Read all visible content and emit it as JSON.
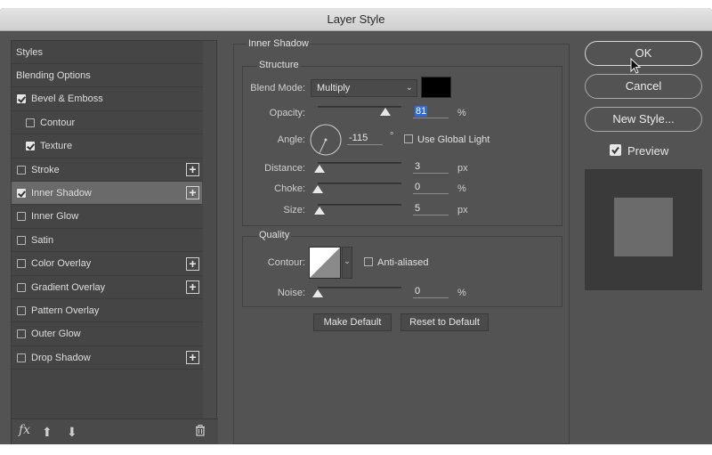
{
  "window": {
    "title": "Layer Style"
  },
  "styles_list": [
    {
      "label": "Styles",
      "checkbox": false,
      "checked": false,
      "indent": false,
      "plus": false,
      "selected": false
    },
    {
      "label": "Blending Options",
      "checkbox": false,
      "checked": false,
      "indent": false,
      "plus": false,
      "selected": false
    },
    {
      "label": "Bevel & Emboss",
      "checkbox": true,
      "checked": true,
      "indent": false,
      "plus": false,
      "selected": false
    },
    {
      "label": "Contour",
      "checkbox": true,
      "checked": false,
      "indent": true,
      "plus": false,
      "selected": false
    },
    {
      "label": "Texture",
      "checkbox": true,
      "checked": true,
      "indent": true,
      "plus": false,
      "selected": false
    },
    {
      "label": "Stroke",
      "checkbox": true,
      "checked": false,
      "indent": false,
      "plus": true,
      "selected": false
    },
    {
      "label": "Inner Shadow",
      "checkbox": true,
      "checked": true,
      "indent": false,
      "plus": true,
      "selected": true
    },
    {
      "label": "Inner Glow",
      "checkbox": true,
      "checked": false,
      "indent": false,
      "plus": false,
      "selected": false
    },
    {
      "label": "Satin",
      "checkbox": true,
      "checked": false,
      "indent": false,
      "plus": false,
      "selected": false
    },
    {
      "label": "Color Overlay",
      "checkbox": true,
      "checked": false,
      "indent": false,
      "plus": true,
      "selected": false
    },
    {
      "label": "Gradient Overlay",
      "checkbox": true,
      "checked": false,
      "indent": false,
      "plus": true,
      "selected": false
    },
    {
      "label": "Pattern Overlay",
      "checkbox": true,
      "checked": false,
      "indent": false,
      "plus": false,
      "selected": false
    },
    {
      "label": "Outer Glow",
      "checkbox": true,
      "checked": false,
      "indent": false,
      "plus": false,
      "selected": false
    },
    {
      "label": "Drop Shadow",
      "checkbox": true,
      "checked": false,
      "indent": false,
      "plus": true,
      "selected": false
    }
  ],
  "footer": {
    "fx_label": "fx",
    "icons": [
      "fx-icon",
      "move-up-icon",
      "move-down-icon",
      "trash-icon"
    ]
  },
  "inner_shadow": {
    "section_title": "Inner Shadow",
    "structure_title": "Structure",
    "blend_mode_label": "Blend Mode:",
    "blend_mode_value": "Multiply",
    "shadow_color": "#000000",
    "opacity_label": "Opacity:",
    "opacity_value": "81",
    "opacity_unit": "%",
    "opacity_level": 0.81,
    "angle_label": "Angle:",
    "angle_value": "-115",
    "angle_unit": "°",
    "use_global_light_label": "Use Global Light",
    "distance_label": "Distance:",
    "distance_value": "3",
    "distance_unit": "px",
    "distance_level": 0.02,
    "choke_label": "Choke:",
    "choke_value": "0",
    "choke_unit": "%",
    "choke_level": 0.0,
    "size_label": "Size:",
    "size_value": "5",
    "size_unit": "px",
    "size_level": 0.02
  },
  "quality": {
    "title": "Quality",
    "contour_label": "Contour:",
    "anti_aliased_label": "Anti-aliased",
    "noise_label": "Noise:",
    "noise_value": "0",
    "noise_unit": "%",
    "noise_level": 0.0
  },
  "buttons": {
    "make_default": "Make Default",
    "reset_to_default": "Reset to Default",
    "ok": "OK",
    "cancel": "Cancel",
    "new_style": "New Style...",
    "preview_label": "Preview"
  },
  "colors": {
    "dialog_bg": "#535353",
    "selected_row": "#6a6a6a",
    "highlight": "#2f6bd9"
  }
}
